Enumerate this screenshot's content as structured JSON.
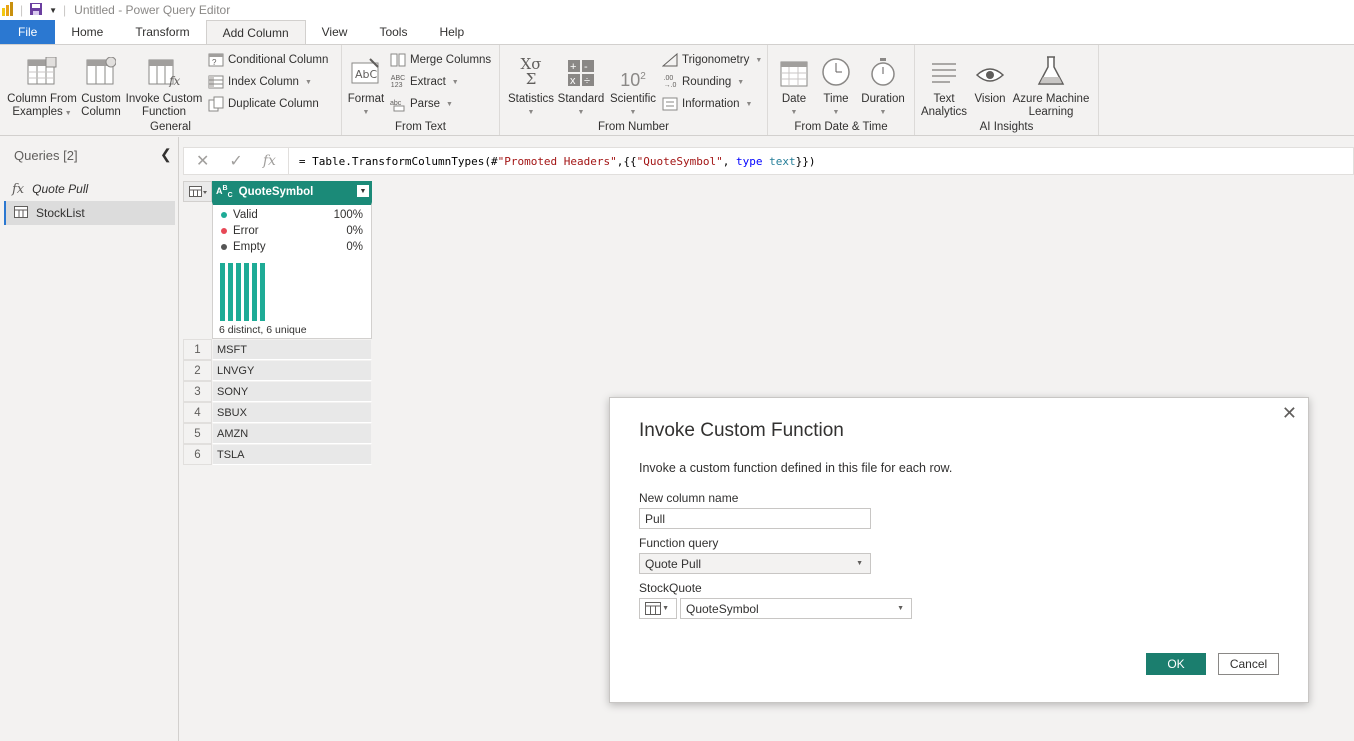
{
  "window": {
    "title": "Untitled - Power Query Editor"
  },
  "tabs": [
    "File",
    "Home",
    "Transform",
    "Add Column",
    "View",
    "Tools",
    "Help"
  ],
  "active_tab": "Add Column",
  "ribbon": {
    "general": {
      "label": "General",
      "column_from_examples": [
        "Column From",
        "Examples"
      ],
      "custom_column": [
        "Custom",
        "Column"
      ],
      "invoke_custom_function": [
        "Invoke Custom",
        "Function"
      ],
      "conditional_column": "Conditional Column",
      "index_column": "Index Column",
      "duplicate_column": "Duplicate Column"
    },
    "from_text": {
      "label": "From Text",
      "format": "Format",
      "merge_columns": "Merge Columns",
      "extract": "Extract",
      "parse": "Parse"
    },
    "from_number": {
      "label": "From Number",
      "statistics": "Statistics",
      "standard": "Standard",
      "scientific": "Scientific",
      "trigonometry": "Trigonometry",
      "rounding": "Rounding",
      "information": "Information"
    },
    "from_date_time": {
      "label": "From Date & Time",
      "date": "Date",
      "time": "Time",
      "duration": "Duration"
    },
    "ai_insights": {
      "label": "AI Insights",
      "text_analytics": [
        "Text",
        "Analytics"
      ],
      "vision": "Vision",
      "azure_ml": [
        "Azure Machine",
        "Learning"
      ]
    }
  },
  "queries": {
    "header": "Queries [2]",
    "items": [
      {
        "name": "Quote Pull",
        "type": "function"
      },
      {
        "name": "StockList",
        "type": "table",
        "selected": true
      }
    ]
  },
  "formula_bar": {
    "p1": "= Table.TransformColumnTypes(#",
    "s1": "\"Promoted Headers\"",
    "p2": ",{{",
    "s2": "\"QuoteSymbol\"",
    "p3": ", ",
    "k1": "type",
    "p4": " ",
    "t1": "text",
    "p5": "}})"
  },
  "table": {
    "column": "QuoteSymbol",
    "column_type": "ABC",
    "profile": {
      "valid_label": "Valid",
      "valid_pct": "100%",
      "error_label": "Error",
      "error_pct": "0%",
      "empty_label": "Empty",
      "empty_pct": "0%",
      "summary": "6 distinct, 6 unique",
      "colors": {
        "valid": "#1eab96",
        "error": "#e74856",
        "empty": "#555555"
      }
    },
    "rows": [
      {
        "n": "1",
        "v": "MSFT"
      },
      {
        "n": "2",
        "v": "LNVGY"
      },
      {
        "n": "3",
        "v": "SONY"
      },
      {
        "n": "4",
        "v": "SBUX"
      },
      {
        "n": "5",
        "v": "AMZN"
      },
      {
        "n": "6",
        "v": "TSLA"
      }
    ]
  },
  "dialog": {
    "title": "Invoke Custom Function",
    "description": "Invoke a custom function defined in this file for each row.",
    "new_column_label": "New column name",
    "new_column_value": "Pull",
    "function_query_label": "Function query",
    "function_query_value": "Quote Pull",
    "param_label": "StockQuote",
    "param_value": "QuoteSymbol",
    "ok": "OK",
    "cancel": "Cancel"
  },
  "colors": {
    "accent": "#2b78d1",
    "teal": "#1b8a78"
  }
}
